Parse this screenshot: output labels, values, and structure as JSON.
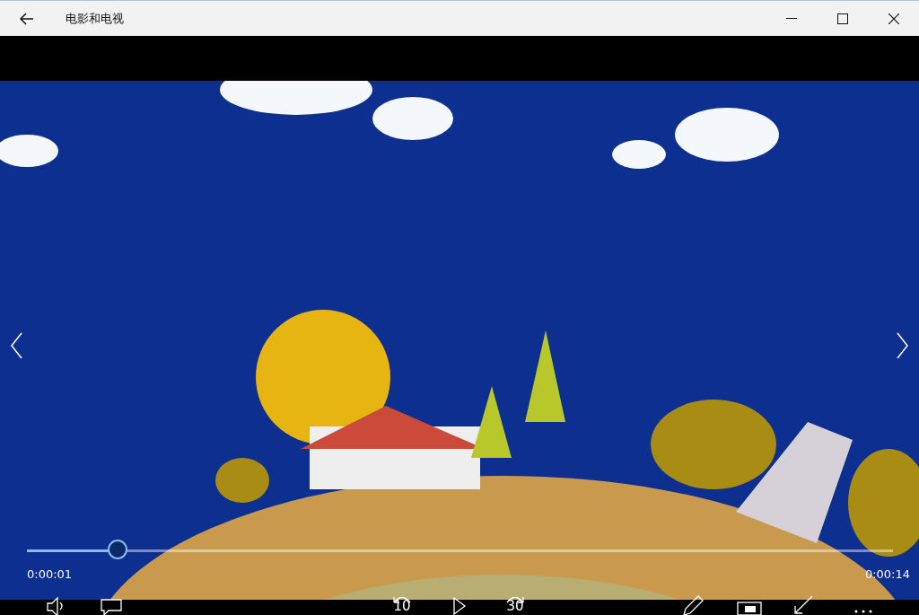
{
  "window": {
    "title": "电影和电视"
  },
  "player": {
    "position": "0:00:01",
    "duration": "0:00:14",
    "level": 0.105,
    "skip_back": "10",
    "skip_forward": "30"
  }
}
